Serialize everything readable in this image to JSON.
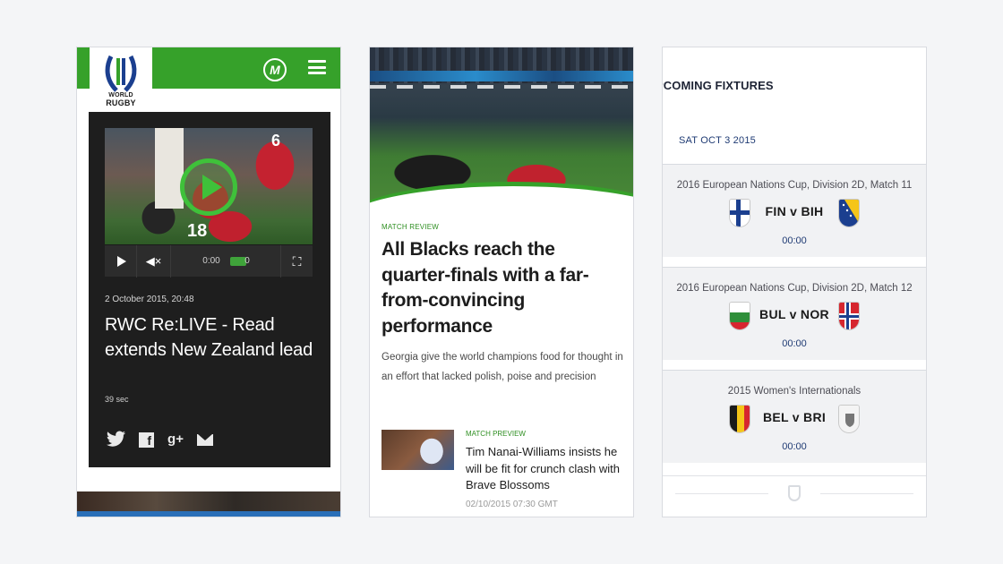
{
  "phone1": {
    "logo": {
      "line1": "WORLD",
      "line2": "RUGBY"
    },
    "header_icon": "M",
    "video": {
      "number_a": "6",
      "number_b": "18",
      "time": "0:00",
      "duration_end": "0"
    },
    "date": "2 October 2015, 20:48",
    "title": "RWC Re:LIVE - Read extends New Zealand lead",
    "duration": "39 sec",
    "share_icons": {
      "twitter": "twitter-icon",
      "facebook": "f",
      "google_plus": "g+",
      "email": "email-icon"
    },
    "colors": {
      "brand_green": "#36a12a",
      "card": "#1e1e1e"
    }
  },
  "phone2": {
    "tag": "MATCH REVIEW",
    "title": "All Blacks reach the quarter-finals with a far-from-convincing performance",
    "summary": "Georgia give the world champions food for thought in an effort that lacked polish, poise and precision",
    "related": {
      "tag": "MATCH PREVIEW",
      "title": "Tim Nanai-Williams insists he will be fit for crunch clash with Brave Blossoms",
      "date": "02/10/2015 07:30 GMT"
    }
  },
  "phone3": {
    "heading": "PCOMING FIXTURES",
    "date": "SAT OCT 3 2015",
    "fixtures": [
      {
        "competition": "2016 European Nations Cup, Division 2D, Match 11",
        "teams": "FIN v BIH",
        "time": "00:00"
      },
      {
        "competition": "2016 European Nations Cup, Division 2D, Match 12",
        "teams": "BUL v NOR",
        "time": "00:00"
      },
      {
        "competition": "2015 Women's Internationals",
        "teams": "BEL v BRI",
        "time": "00:00"
      }
    ]
  }
}
